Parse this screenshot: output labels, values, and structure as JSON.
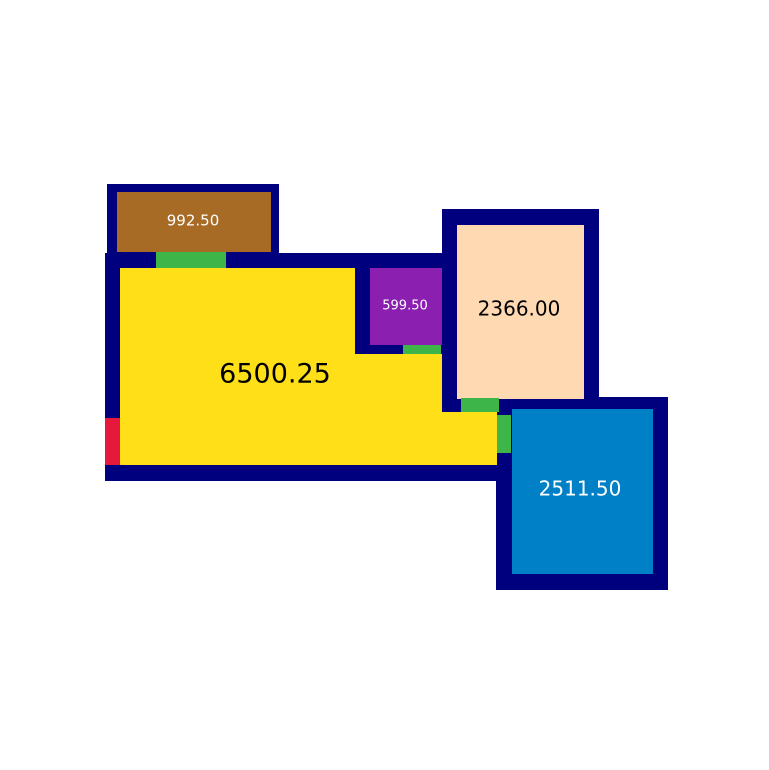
{
  "colors": {
    "wall": "#00007f",
    "background": "#ffffff",
    "door": "#3db548",
    "entrance": "#e5193b",
    "room_main": "#ffdf17",
    "room_top_left": "#a86b26",
    "room_small": "#8b1fb0",
    "room_right_top": "#ffd9b2",
    "room_bottom_right": "#0080c6",
    "label_dark": "#000000",
    "label_light": "#ffffff"
  },
  "rooms": {
    "main": {
      "area_label": "6500.25"
    },
    "top_left": {
      "area_label": "992.50"
    },
    "small": {
      "area_label": "599.50"
    },
    "right_top": {
      "area_label": "2366.00"
    },
    "bottom_right": {
      "area_label": "2511.50"
    }
  }
}
